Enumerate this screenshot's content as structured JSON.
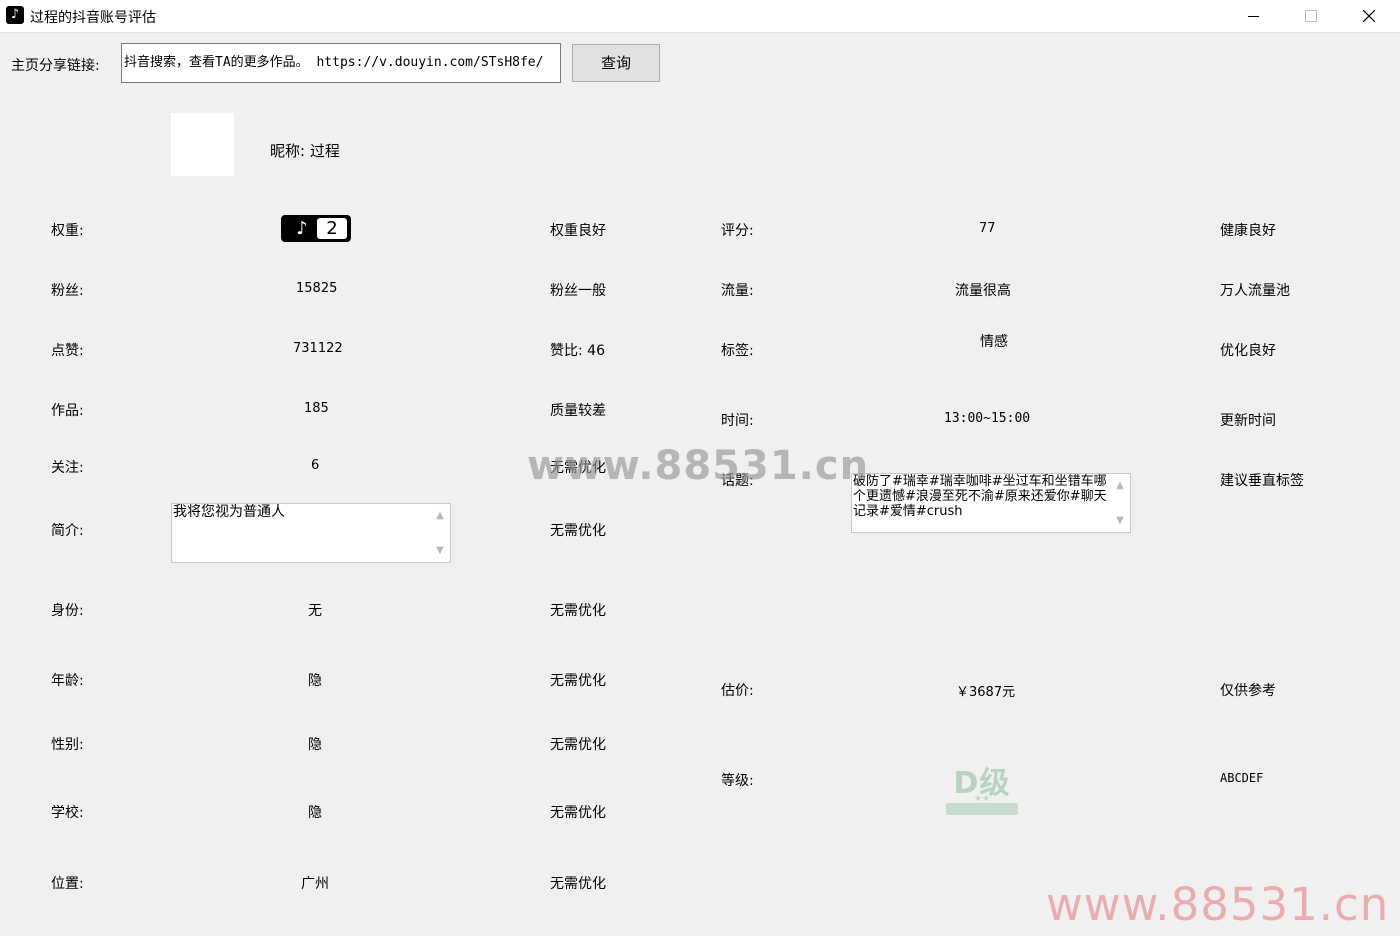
{
  "window": {
    "title": "过程的抖音账号评估",
    "icon": "douyin-icon"
  },
  "search": {
    "label": "主页分享链接:",
    "value": "抖音搜索，查看TA的更多作品。 https://v.douyin.com/STsH8fe/",
    "button": "查询"
  },
  "profile": {
    "nickname": "昵称: 过程"
  },
  "left_rows": {
    "weight": {
      "label": "权重:",
      "badge_value": "2",
      "status": "权重良好"
    },
    "fans": {
      "label": "粉丝:",
      "value": "15825",
      "status": "粉丝一般"
    },
    "likes": {
      "label": "点赞:",
      "value": "731122",
      "status": "赞比: 46"
    },
    "works": {
      "label": "作品:",
      "value": "185",
      "status": "质量较差"
    },
    "following": {
      "label": "关注:",
      "value": "6",
      "status": "无需优化"
    },
    "bio": {
      "label": "简介:",
      "value": "我将您视为普通人",
      "status": "无需优化"
    },
    "identity": {
      "label": "身份:",
      "value": "无",
      "status": "无需优化"
    },
    "age": {
      "label": "年龄:",
      "value": "隐",
      "status": "无需优化"
    },
    "gender": {
      "label": "性别:",
      "value": "隐",
      "status": "无需优化"
    },
    "school": {
      "label": "学校:",
      "value": "隐",
      "status": "无需优化"
    },
    "location": {
      "label": "位置:",
      "value": "广州",
      "status": "无需优化"
    }
  },
  "right_rows": {
    "score": {
      "label": "评分:",
      "value": "77",
      "status": "健康良好"
    },
    "traffic": {
      "label": "流量:",
      "value": "流量很高",
      "status": "万人流量池"
    },
    "tags": {
      "label": "标签:",
      "value": "情感",
      "status": "优化良好"
    },
    "time": {
      "label": "时间:",
      "value": "13:00~15:00",
      "status": "更新时间"
    },
    "topics": {
      "label": "话题:",
      "value": "破防了#瑞幸#瑞幸咖啡#坐过车和坐错车哪个更遗憾#浪漫至死不渝#原来还爱你#聊天记录#爱情#crush",
      "status": "建议垂直标签"
    },
    "valuation": {
      "label": "估价:",
      "value": "￥3687元",
      "status": "仅供参考"
    },
    "grade": {
      "label": "等级:",
      "badge_text": "D级",
      "status": "ABCDEF"
    }
  },
  "watermarks": {
    "center": "www.88531.cn",
    "corner": "www.88531.cn"
  }
}
